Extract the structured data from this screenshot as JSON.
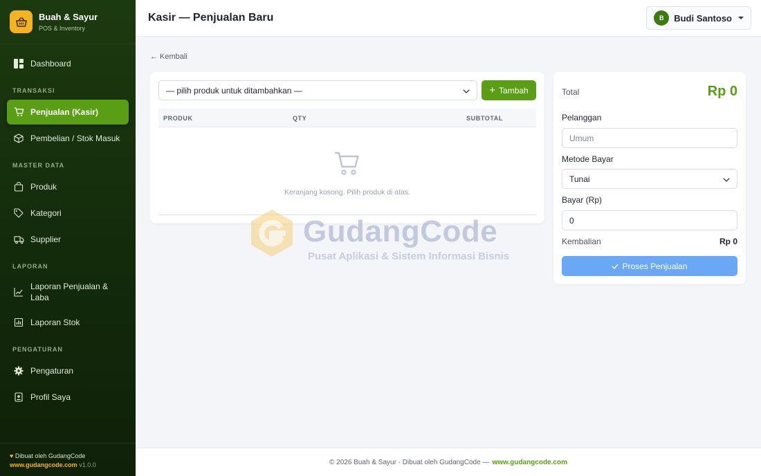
{
  "brand": {
    "name": "Buah & Sayur",
    "subtitle": "POS & Inventory",
    "icon": "basket-icon"
  },
  "sidebar": {
    "items": [
      {
        "label": "Dashboard",
        "icon": "dashboard-icon"
      },
      {
        "label": "Penjualan (Kasir)",
        "icon": "cart-icon",
        "active": true
      },
      {
        "label": "Pembelian / Stok Masuk",
        "icon": "box-icon"
      },
      {
        "label": "Produk",
        "icon": "bag-icon"
      },
      {
        "label": "Kategori",
        "icon": "tag-icon"
      },
      {
        "label": "Supplier",
        "icon": "truck-icon"
      },
      {
        "label": "Laporan Penjualan & Laba",
        "icon": "chart-line-icon"
      },
      {
        "label": "Laporan Stok",
        "icon": "bar-report-icon"
      },
      {
        "label": "Pengaturan",
        "icon": "gear-icon"
      },
      {
        "label": "Profil Saya",
        "icon": "person-badge-icon"
      }
    ],
    "sections": [
      "TRANSAKSI",
      "MASTER DATA",
      "LAPORAN",
      "PENGATURAN"
    ],
    "footer": {
      "credit": "Dibuat oleh GudangCode",
      "url": "www.gudangcode.com",
      "version": "v1.0.0"
    }
  },
  "header": {
    "title": "Kasir — Penjualan Baru",
    "user": {
      "initial": "B",
      "name": "Budi Santoso"
    }
  },
  "main": {
    "back_label": "← Kembali",
    "product_select": {
      "placeholder": "— pilih produk untuk ditambahkan —"
    },
    "add_button": "Tambah",
    "cart": {
      "columns": [
        "PRODUK",
        "QTY",
        "SUBTOTAL"
      ],
      "rows": [],
      "empty_message": "Keranjang kosong. Pilih produk di atas."
    }
  },
  "summary": {
    "total_label": "Total",
    "total_value": "Rp 0",
    "customer_label": "Pelanggan",
    "customer_placeholder": "Umum",
    "payment_method_label": "Metode Bayar",
    "payment_method_value": "Tunai",
    "paid_label": "Bayar (Rp)",
    "paid_value": "0",
    "change_label": "Kembalian",
    "change_value": "Rp 0",
    "process_button": "Proses Penjualan"
  },
  "watermark": {
    "title": "GudangCode",
    "subtitle": "Pusat Aplikasi & Sistem Informasi Bisnis"
  },
  "footer": {
    "text": "© 2026 Buah & Sayur · Dibuat oleh GudangCode —",
    "link": "www.gudangcode.com"
  },
  "colors": {
    "primary": "#5a9e16",
    "accent": "#f5b324",
    "sidebar": "#132a0b",
    "process_button": "#6aa8f5"
  }
}
